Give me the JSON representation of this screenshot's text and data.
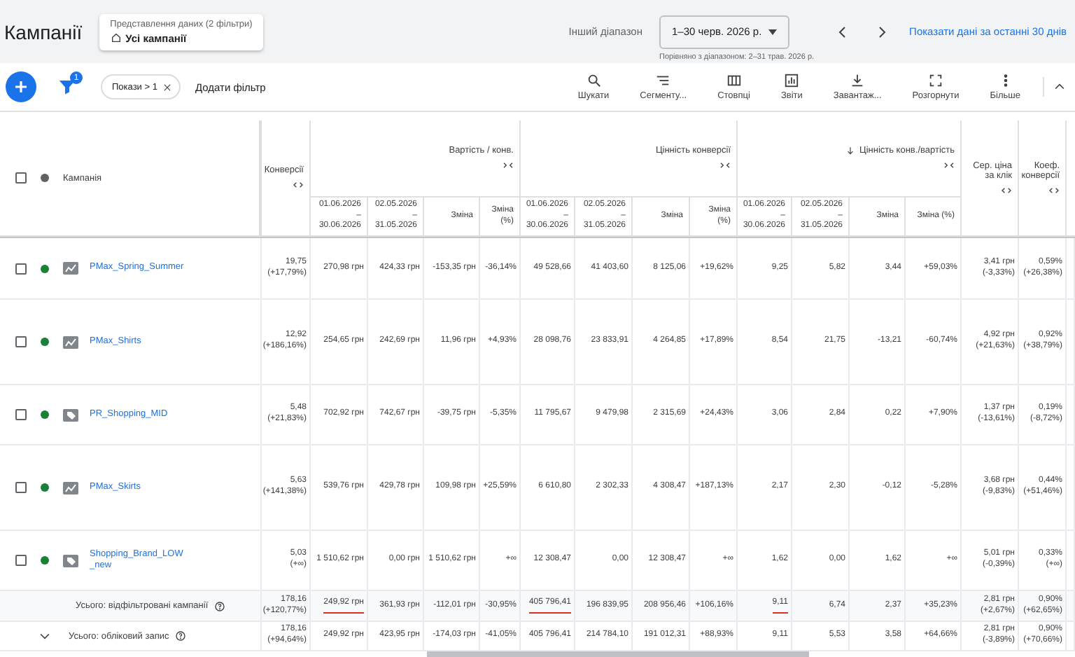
{
  "header": {
    "title": "Кампанії",
    "view": {
      "label": "Представлення даних (2 фільтри)",
      "value": "Усі кампанії"
    },
    "range": {
      "label": "Інший діапазон",
      "value": "1–30 черв. 2026 р.",
      "comparison": "Порівняно з діапазоном: 2–31 трав. 2026 р."
    },
    "last30_link": "Показати дані за останні 30 днів"
  },
  "toolbar": {
    "filter_badge": "1",
    "filters": [
      {
        "label": "Покази > 1"
      }
    ],
    "add_filter": "Додати фільтр",
    "tools": [
      "Шукати",
      "Сегменту...",
      "Стовпці",
      "Звіти",
      "Завантаж...",
      "Розгорнути",
      "Більше"
    ]
  },
  "table": {
    "columns": {
      "select_all_checked": false,
      "campaign": "Кампанія",
      "conversions": "Конверсії",
      "groups": [
        {
          "title": "Вартість / конв.",
          "sorted": false,
          "subcolumns": [
            "01.06.2026\n–\n30.06.2026",
            "02.05.2026\n–\n31.05.2026",
            "Зміна",
            "Зміна (%)"
          ]
        },
        {
          "title": "Цінність конверсії",
          "sorted": false,
          "subcolumns": [
            "01.06.2026\n–\n30.06.2026",
            "02.05.2026\n–\n31.05.2026",
            "Зміна",
            "Зміна (%)"
          ]
        },
        {
          "title": "Цінність конв./вартість",
          "sorted": true,
          "subcolumns": [
            "01.06.2026\n–\n30.06.2026",
            "02.05.2026\n–\n31.05.2026",
            "Зміна",
            "Зміна (%)"
          ]
        }
      ],
      "avg_cpc": "Сер. ціна за клік",
      "conv_rate": "Коеф. конверсії"
    },
    "rows": [
      {
        "name": "PMax_Spring_Summer",
        "kind": "pmax",
        "enabled": true,
        "checked": false,
        "cells": [
          "19,75\n(+17,79%)",
          "270,98 грн",
          "424,33 грн",
          "-153,35 грн",
          "-36,14%",
          "49 528,66",
          "41 403,60",
          "8 125,06",
          "+19,62%",
          "9,25",
          "5,82",
          "3,44",
          "+59,03%",
          "3,41 грн\n(-3,33%)",
          "0,59%\n(+26,38%)"
        ]
      },
      {
        "name": "PMax_Shirts",
        "kind": "pmax",
        "enabled": true,
        "checked": false,
        "cells": [
          "12,92\n(+186,16%)",
          "254,65 грн",
          "242,69 грн",
          "11,96 грн",
          "+4,93%",
          "28 098,76",
          "23 833,91",
          "4 264,85",
          "+17,89%",
          "8,54",
          "21,75",
          "-13,21",
          "-60,74%",
          "4,92 грн\n(+21,63%)",
          "0,92%\n(+38,79%)"
        ]
      },
      {
        "name": "PR_Shopping_MID",
        "kind": "shopping",
        "enabled": true,
        "checked": false,
        "cells": [
          "5,48\n(+21,83%)",
          "702,92 грн",
          "742,67 грн",
          "-39,75 грн",
          "-5,35%",
          "11 795,67",
          "9 479,98",
          "2 315,69",
          "+24,43%",
          "3,06",
          "2,84",
          "0,22",
          "+7,90%",
          "1,37 грн\n(-13,61%)",
          "0,19%\n(-8,72%)"
        ]
      },
      {
        "name": "PMax_Skirts",
        "kind": "pmax",
        "enabled": true,
        "checked": false,
        "cells": [
          "5,63\n(+141,38%)",
          "539,76 грн",
          "429,78 грн",
          "109,98 грн",
          "+25,59%",
          "6 610,80",
          "2 302,33",
          "4 308,47",
          "+187,13%",
          "2,17",
          "2,30",
          "-0,12",
          "-5,28%",
          "3,68 грн\n(-9,83%)",
          "0,44%\n(+51,46%)"
        ]
      },
      {
        "name": "Shopping_Brand_LOW_new",
        "kind": "shopping",
        "enabled": true,
        "checked": false,
        "cells": [
          "5,03\n(+∞)",
          "1 510,62 грн",
          "0,00 грн",
          "1 510,62 грн",
          "+∞",
          "12 308,47",
          "0,00",
          "12 308,47",
          "+∞",
          "1,62",
          "0,00",
          "1,62",
          "+∞",
          "5,01 грн\n(-0,39%)",
          "0,33%\n(+∞)"
        ]
      }
    ],
    "totals": [
      {
        "label": "Усього: відфільтровані кампанії",
        "expandable": false,
        "cells": [
          "178,16\n(+120,77%)",
          {
            "text": "249,92 грн",
            "underlined": true
          },
          "361,93 грн",
          "-112,01 грн",
          "-30,95%",
          {
            "text": "405 796,41",
            "underlined": true
          },
          "196 839,95",
          "208 956,46",
          "+106,16%",
          {
            "text": "9,11",
            "underlined": true
          },
          "6,74",
          "2,37",
          "+35,23%",
          "2,81 грн\n(+2,67%)",
          "0,90%\n(+62,65%)"
        ]
      },
      {
        "label": "Усього: обліковий запис",
        "expandable": true,
        "cells": [
          "178,16\n(+94,64%)",
          "249,92 грн",
          "423,95 грн",
          "-174,03 грн",
          "-41,05%",
          "405 796,41",
          "214 784,10",
          "191 012,31",
          "+88,93%",
          "9,11",
          "5,53",
          "3,58",
          "+64,66%",
          "2,81 грн\n(-3,89%)",
          "0,90%\n(+70,66%)"
        ]
      }
    ]
  }
}
